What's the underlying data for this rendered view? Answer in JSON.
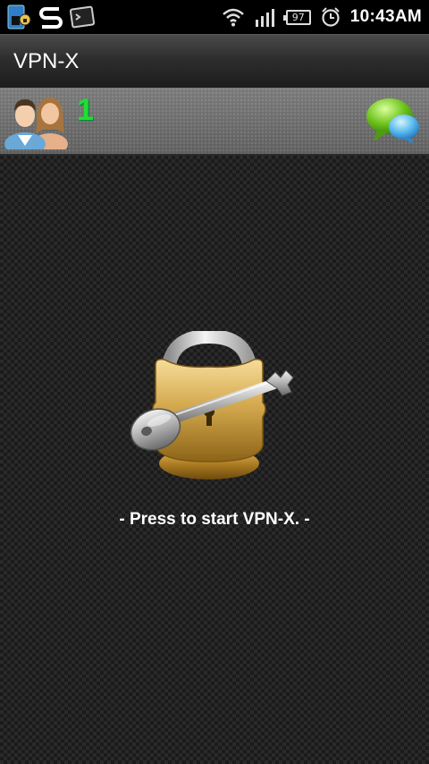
{
  "status_bar": {
    "time": "10:43AM",
    "battery_level": "97",
    "icons": [
      "sim-icon",
      "s-app-icon",
      "terminal-icon",
      "wifi-icon",
      "signal-icon",
      "battery-icon",
      "alarm-icon"
    ]
  },
  "title_bar": {
    "title": "VPN-X"
  },
  "toolbar": {
    "user_count": "1",
    "icons": [
      "users-icon",
      "chat-icon"
    ]
  },
  "main": {
    "start_text": "- Press to start VPN-X. -",
    "icon": "padlock-key-icon"
  },
  "colors": {
    "user_count": "#22dd33",
    "title_bar": "#2e2e2e",
    "toolbar": "#6a6a6a",
    "background": "#1b1b1b"
  }
}
